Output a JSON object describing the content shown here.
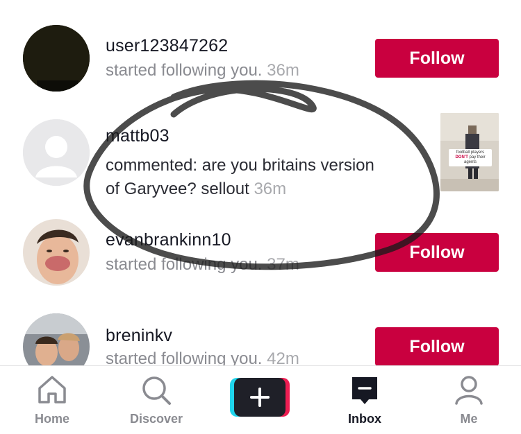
{
  "notifications": [
    {
      "username": "user123847262",
      "text": "started following you.",
      "time": "36m",
      "action": "Follow"
    },
    {
      "username": "mattb03",
      "text_line1": "commented: are you britains version",
      "text_line2": "of Garyvee? sellout",
      "time": "36m",
      "thumbnail_caption": {
        "line1": "football players",
        "highlight": "DON'T",
        "line2": "pay their",
        "line3": "agents"
      }
    },
    {
      "username": "evanbrankinn10",
      "text": "started following you.",
      "time": "37m",
      "action": "Follow"
    },
    {
      "username": "breninkv",
      "text": "started following you.",
      "time": "42m",
      "action": "Follow"
    }
  ],
  "tabbar": {
    "tabs": [
      {
        "label": "Home",
        "icon": "home-icon"
      },
      {
        "label": "Discover",
        "icon": "search-icon"
      },
      {
        "label": "",
        "icon": "plus-icon"
      },
      {
        "label": "Inbox",
        "icon": "inbox-icon",
        "active": true
      },
      {
        "label": "Me",
        "icon": "profile-icon"
      }
    ]
  },
  "colors": {
    "accent": "#c9003f",
    "text": "#161823",
    "muted": "#8a8b91",
    "cyan": "#20d5ec",
    "pink": "#ee1d52"
  }
}
